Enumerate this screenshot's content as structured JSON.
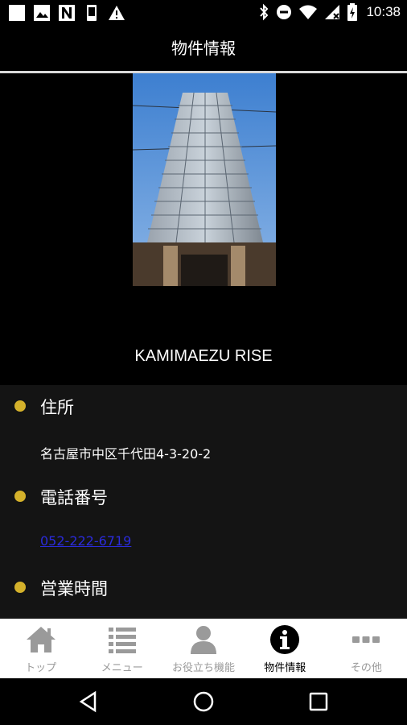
{
  "status_bar": {
    "time": "10:38",
    "left_icons": [
      "square-icon",
      "image-icon",
      "n-icon",
      "phone-icon",
      "warning-icon"
    ],
    "right_icons": [
      "bluetooth-icon",
      "do-not-disturb-icon",
      "wifi-icon",
      "no-signal-icon",
      "battery-icon"
    ]
  },
  "header": {
    "title": "物件情報"
  },
  "property": {
    "name": "KAMIMAEZU RISE"
  },
  "info": {
    "address": {
      "heading": "住所",
      "value": "名古屋市中区千代田4-3-20-2"
    },
    "phone": {
      "heading": "電話番号",
      "value": "052-222-6719"
    },
    "hours": {
      "heading": "営業時間"
    }
  },
  "bottom_nav": {
    "items": [
      {
        "label": "トップ",
        "icon": "home-icon"
      },
      {
        "label": "メニュー",
        "icon": "list-icon"
      },
      {
        "label": "お役立ち機能",
        "icon": "person-icon"
      },
      {
        "label": "物件情報",
        "icon": "info-icon"
      },
      {
        "label": "その他",
        "icon": "more-icon"
      }
    ],
    "active_index": 3
  },
  "system_nav": {
    "buttons": [
      "back-icon",
      "home-circle-icon",
      "recents-icon"
    ]
  },
  "colors": {
    "accent": "#d4b12b",
    "link": "#2b2bdb",
    "section_bg": "#141414",
    "nav_inactive": "#9a9a9a"
  }
}
